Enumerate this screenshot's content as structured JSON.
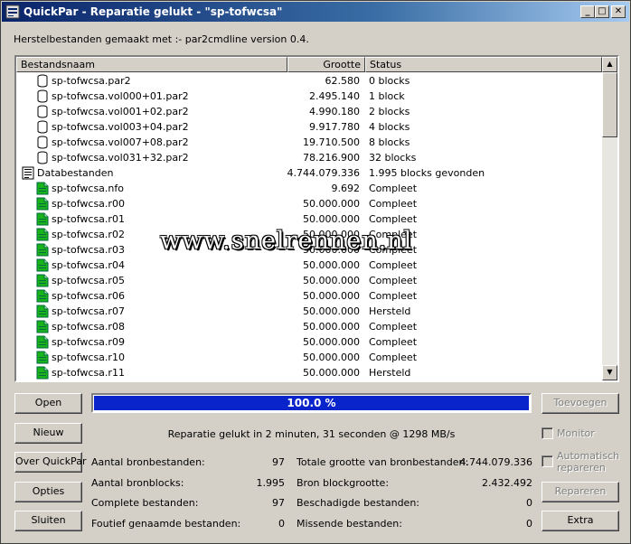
{
  "window": {
    "title": "QuickPar - Reparatie gelukt - \"sp-tofwcsa\"",
    "minimize": "_",
    "maximize": "□",
    "close": "✕"
  },
  "caption": "Herstelbestanden gemaakt met :- par2cmdline version 0.4.",
  "list": {
    "columns": [
      "Bestandsnaam",
      "Grootte",
      "Status"
    ],
    "rows": [
      {
        "indent": 1,
        "icon": "par2-file-icon",
        "name": "sp-tofwcsa.par2",
        "size": "62.580",
        "status": "0 blocks"
      },
      {
        "indent": 1,
        "icon": "par2-file-icon",
        "name": "sp-tofwcsa.vol000+01.par2",
        "size": "2.495.140",
        "status": "1 block"
      },
      {
        "indent": 1,
        "icon": "par2-file-icon",
        "name": "sp-tofwcsa.vol001+02.par2",
        "size": "4.990.180",
        "status": "2 blocks"
      },
      {
        "indent": 1,
        "icon": "par2-file-icon",
        "name": "sp-tofwcsa.vol003+04.par2",
        "size": "9.917.780",
        "status": "4 blocks"
      },
      {
        "indent": 1,
        "icon": "par2-file-icon",
        "name": "sp-tofwcsa.vol007+08.par2",
        "size": "19.710.500",
        "status": "8 blocks"
      },
      {
        "indent": 1,
        "icon": "par2-file-icon",
        "name": "sp-tofwcsa.vol031+32.par2",
        "size": "78.216.900",
        "status": "32 blocks"
      },
      {
        "indent": 0,
        "icon": "data-files-icon",
        "name": "Databestanden",
        "size": "4.744.079.336",
        "status": "1.995 blocks gevonden"
      },
      {
        "indent": 1,
        "icon": "complete-file-icon",
        "name": "sp-tofwcsa.nfo",
        "size": "9.692",
        "status": "Compleet"
      },
      {
        "indent": 1,
        "icon": "complete-file-icon",
        "name": "sp-tofwcsa.r00",
        "size": "50.000.000",
        "status": "Compleet"
      },
      {
        "indent": 1,
        "icon": "complete-file-icon",
        "name": "sp-tofwcsa.r01",
        "size": "50.000.000",
        "status": "Compleet"
      },
      {
        "indent": 1,
        "icon": "complete-file-icon",
        "name": "sp-tofwcsa.r02",
        "size": "50.000.000",
        "status": "Compleet"
      },
      {
        "indent": 1,
        "icon": "complete-file-icon",
        "name": "sp-tofwcsa.r03",
        "size": "50.000.000",
        "status": "Compleet"
      },
      {
        "indent": 1,
        "icon": "complete-file-icon",
        "name": "sp-tofwcsa.r04",
        "size": "50.000.000",
        "status": "Compleet"
      },
      {
        "indent": 1,
        "icon": "complete-file-icon",
        "name": "sp-tofwcsa.r05",
        "size": "50.000.000",
        "status": "Compleet"
      },
      {
        "indent": 1,
        "icon": "complete-file-icon",
        "name": "sp-tofwcsa.r06",
        "size": "50.000.000",
        "status": "Compleet"
      },
      {
        "indent": 1,
        "icon": "complete-file-icon",
        "name": "sp-tofwcsa.r07",
        "size": "50.000.000",
        "status": "Hersteld"
      },
      {
        "indent": 1,
        "icon": "complete-file-icon",
        "name": "sp-tofwcsa.r08",
        "size": "50.000.000",
        "status": "Compleet"
      },
      {
        "indent": 1,
        "icon": "complete-file-icon",
        "name": "sp-tofwcsa.r09",
        "size": "50.000.000",
        "status": "Compleet"
      },
      {
        "indent": 1,
        "icon": "complete-file-icon",
        "name": "sp-tofwcsa.r10",
        "size": "50.000.000",
        "status": "Compleet"
      },
      {
        "indent": 1,
        "icon": "complete-file-icon",
        "name": "sp-tofwcsa.r11",
        "size": "50.000.000",
        "status": "Hersteld"
      },
      {
        "indent": 1,
        "icon": "complete-file-icon",
        "name": "",
        "size": "",
        "status": ""
      }
    ]
  },
  "buttons": {
    "open": "Open",
    "new": "Nieuw",
    "about": "Over QuickPar",
    "options": "Opties",
    "close": "Sluiten",
    "add": "Toevoegen",
    "repair": "Repareren",
    "extra": "Extra"
  },
  "progress": {
    "value_percent": 100,
    "label": "100.0 %"
  },
  "result_text": "Reparatie gelukt in 2 minuten, 31 seconden @ 1298 MB/s",
  "options": {
    "monitor": "Monitor",
    "auto_repair_line1": "Automatisch",
    "auto_repair_line2": "repareren"
  },
  "stats": {
    "source_files_label": "Aantal bronbestanden:",
    "source_files": "97",
    "total_size_label": "Totale grootte van bronbestanden:",
    "total_size": "4.744.079.336",
    "source_blocks_label": "Aantal bronblocks:",
    "source_blocks": "1.995",
    "block_size_label": "Bron blockgrootte:",
    "block_size": "2.432.492",
    "complete_files_label": "Complete bestanden:",
    "complete_files": "97",
    "damaged_files_label": "Beschadigde bestanden:",
    "damaged_files": "0",
    "misnamed_files_label": "Foutief genaamde bestanden:",
    "misnamed_files": "0",
    "missing_files_label": "Missende bestanden:",
    "missing_files": "0"
  },
  "watermark": "www.snelrennen.nl",
  "colors": {
    "progress": "#0a24cc",
    "title_start": "#0a246a",
    "title_end": "#a6caf0",
    "complete_icon": "#19b419"
  }
}
